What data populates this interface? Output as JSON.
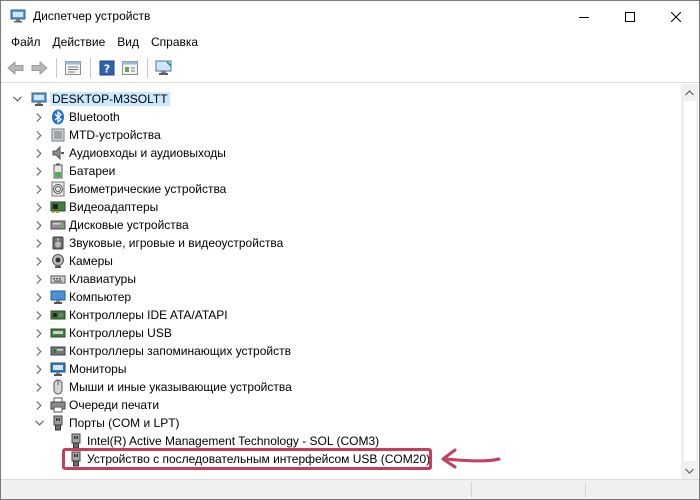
{
  "window": {
    "title": "Диспетчер устройств",
    "controls": [
      "minimize",
      "maximize",
      "close"
    ]
  },
  "menu": [
    {
      "label": "Файл"
    },
    {
      "label": "Действие"
    },
    {
      "label": "Вид"
    },
    {
      "label": "Справка"
    }
  ],
  "toolbar": {
    "buttons": [
      "back-icon",
      "forward-icon",
      "properties-icon",
      "help-icon",
      "view-icon",
      "monitor-scan-icon"
    ]
  },
  "tree": {
    "root": {
      "label": "DESKTOP-M3SOLTT",
      "expanded": true,
      "selected": true
    },
    "categories": [
      {
        "label": "Bluetooth",
        "icon": "bluetooth-icon",
        "expanded": false
      },
      {
        "label": "MTD-устройства",
        "icon": "mtd-icon",
        "expanded": false
      },
      {
        "label": "Аудиовходы и аудиовыходы",
        "icon": "audio-io-icon",
        "expanded": false
      },
      {
        "label": "Батареи",
        "icon": "battery-icon",
        "expanded": false
      },
      {
        "label": "Биометрические устройства",
        "icon": "fingerprint-icon",
        "expanded": false
      },
      {
        "label": "Видеоадаптеры",
        "icon": "display-adapter-icon",
        "expanded": false
      },
      {
        "label": "Дисковые устройства",
        "icon": "disk-drive-icon",
        "expanded": false
      },
      {
        "label": "Звуковые, игровые и видеоустройства",
        "icon": "sound-icon",
        "expanded": false
      },
      {
        "label": "Камеры",
        "icon": "camera-icon",
        "expanded": false
      },
      {
        "label": "Клавиатуры",
        "icon": "keyboard-icon",
        "expanded": false
      },
      {
        "label": "Компьютер",
        "icon": "computer-icon",
        "expanded": false
      },
      {
        "label": "Контроллеры IDE ATA/ATAPI",
        "icon": "ide-controller-icon",
        "expanded": false
      },
      {
        "label": "Контроллеры USB",
        "icon": "usb-controller-icon",
        "expanded": false
      },
      {
        "label": "Контроллеры запоминающих устройств",
        "icon": "storage-controller-icon",
        "expanded": false
      },
      {
        "label": "Мониторы",
        "icon": "monitor-icon",
        "expanded": false
      },
      {
        "label": "Мыши и иные указывающие устройства",
        "icon": "mouse-icon",
        "expanded": false
      },
      {
        "label": "Очереди печати",
        "icon": "printer-icon",
        "expanded": false
      },
      {
        "label": "Порты (COM и LPT)",
        "icon": "port-icon",
        "expanded": true,
        "children": [
          {
            "label": "Intel(R) Active Management Technology - SOL (COM3)",
            "icon": "port-device-icon"
          },
          {
            "label": "Устройство с последовательным интерфейсом USB (COM20)",
            "icon": "port-device-icon",
            "highlighted": true
          }
        ]
      }
    ]
  },
  "annotation": {
    "color": "#c2405e",
    "target": "Устройство с последовательным интерфейсом USB (COM20)"
  },
  "colors": {
    "selection": "#cce8ff",
    "annotation": "#c2405e",
    "accent": "#0078d7"
  }
}
